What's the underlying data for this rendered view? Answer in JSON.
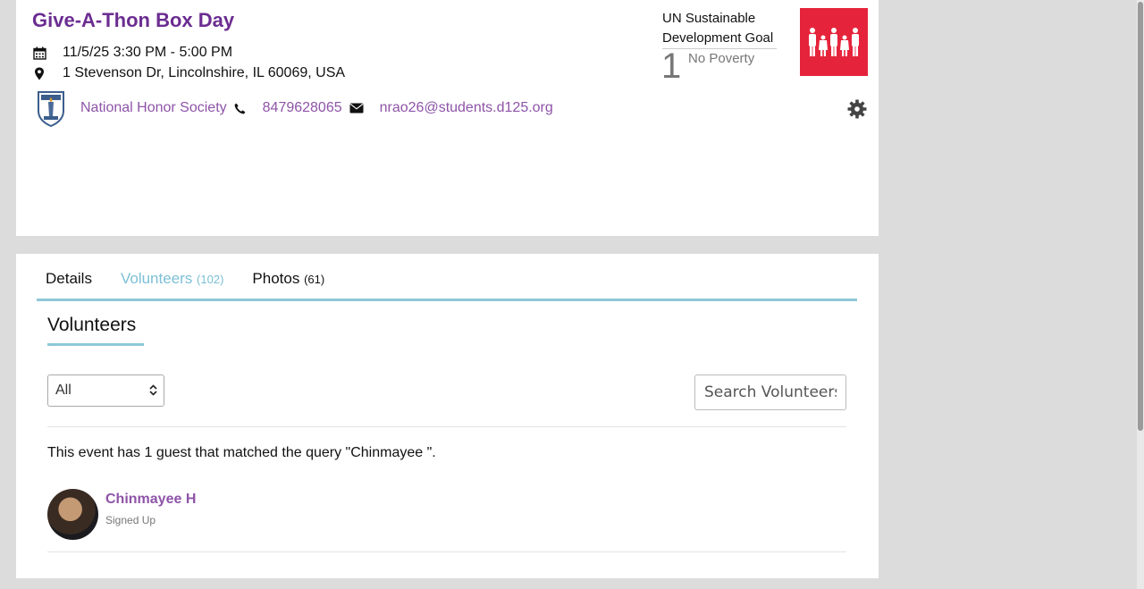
{
  "event": {
    "title": "Give-A-Thon Box Day",
    "datetime": "11/5/25 3:30 PM - 5:00 PM",
    "address": "1 Stevenson Dr, Lincolnshire, IL 60069, USA",
    "org_name": "National Honor Society",
    "phone": "8479628065",
    "email": "nrao26@students.d125.org"
  },
  "sdg": {
    "label": "UN Sustainable Development Goal",
    "number": "1",
    "name": "No Poverty",
    "color": "#e5243b"
  },
  "tabs": [
    {
      "label": "Details",
      "count": ""
    },
    {
      "label": "Volunteers",
      "count": "(102)"
    },
    {
      "label": "Photos",
      "count": "(61)"
    }
  ],
  "volunteers": {
    "section_title": "Volunteers",
    "filter_value": "All",
    "search_placeholder": "Search Volunteers",
    "result_text": "This event has 1 guest that matched the query \"Chinmayee \".",
    "items": [
      {
        "name": "Chinmayee H",
        "status": "Signed Up"
      }
    ]
  },
  "colors": {
    "brand_purple": "#6b2d91",
    "link_purple": "#8e54a8",
    "accent_teal": "#8ec8d8"
  },
  "icons": [
    "calendar-icon",
    "map-pin-icon",
    "phone-icon",
    "envelope-icon",
    "gear-icon",
    "chevron-updown-icon"
  ]
}
